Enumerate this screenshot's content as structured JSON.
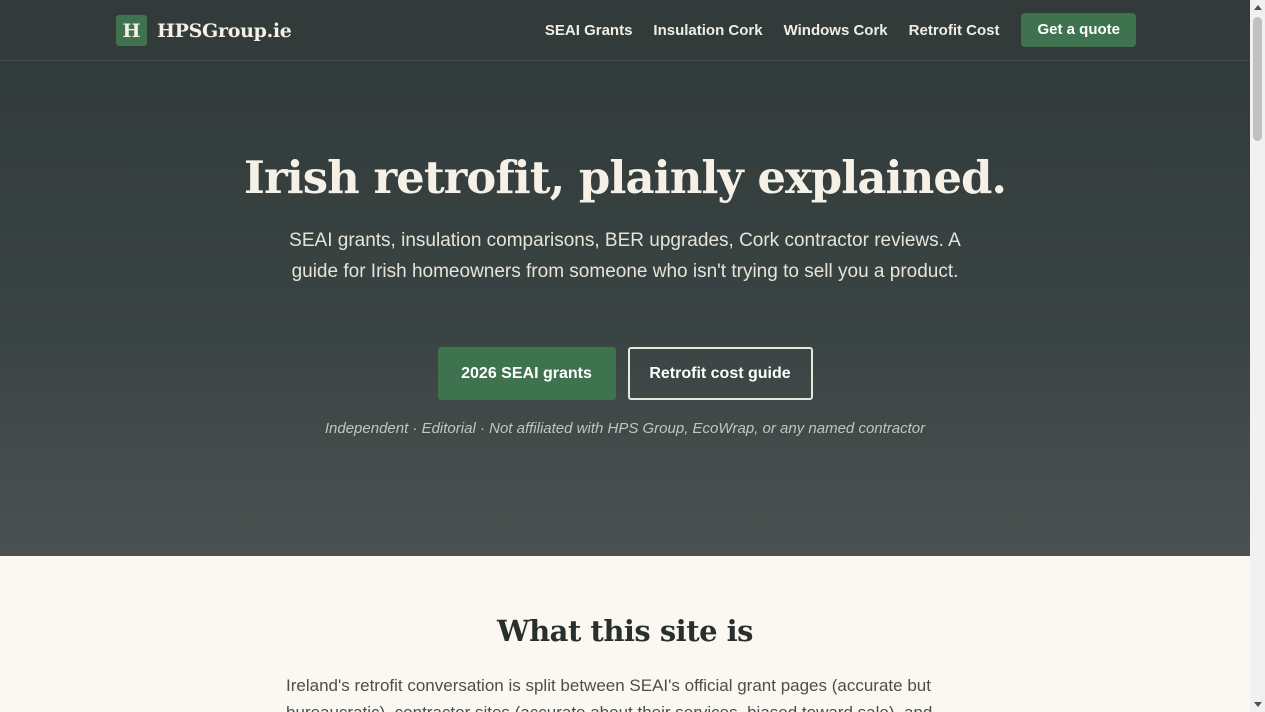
{
  "header": {
    "logo_letter": "H",
    "site_name": "HPSGroup.ie",
    "nav": [
      "SEAI Grants",
      "Insulation Cork",
      "Windows Cork",
      "Retrofit Cost"
    ],
    "cta": "Get a quote"
  },
  "hero": {
    "title": "Irish retrofit, plainly explained.",
    "lede": "SEAI grants, insulation comparisons, BER upgrades, Cork contractor reviews. A guide for Irish homeowners from someone who isn't trying to sell you a product.",
    "primary_button": "2026 SEAI grants",
    "secondary_button": "Retrofit cost guide",
    "disclaimer": "Independent · Editorial · Not affiliated with HPS Group, EcoWrap, or any named contractor"
  },
  "section": {
    "title": "What this site is",
    "body": "Ireland's retrofit conversation is split between SEAI's official grant pages (accurate but bureaucratic), contractor sites (accurate about their services, biased toward sale), and"
  },
  "icons": {
    "scroll_up": "scroll-up-arrow-icon",
    "scroll_down": "scroll-down-arrow-icon"
  },
  "colors": {
    "header_bg": "#323b3a",
    "accent_green": "#3f7350",
    "page_bg": "#fbf8f2"
  }
}
